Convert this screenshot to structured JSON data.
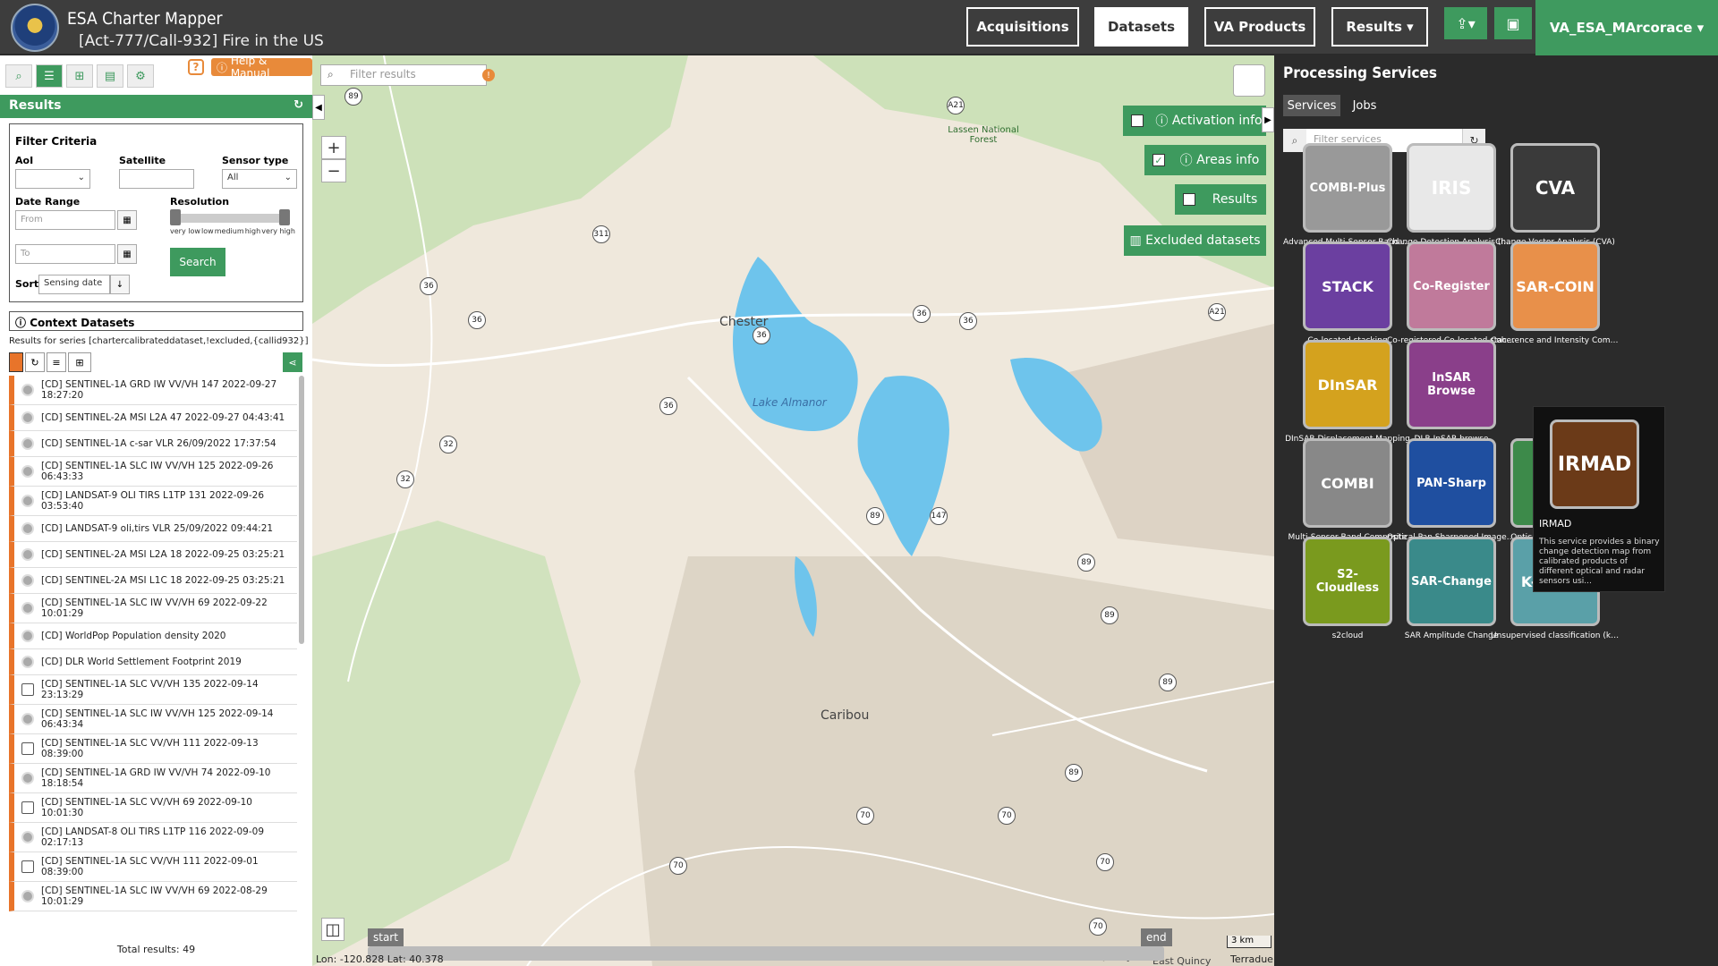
{
  "header": {
    "app_title": "ESA Charter Mapper",
    "call_title": "[Act-777/Call-932] Fire in the US",
    "nav": [
      "Acquisitions",
      "Datasets",
      "VA Products",
      "Results ▾"
    ],
    "user": "VA_ESA_MArcorace ▾"
  },
  "left": {
    "help": "Help & Manual",
    "help_q": "?",
    "results_title": "Results",
    "filter_title": "Filter Criteria",
    "aoi_label": "AoI",
    "satellite_label": "Satellite",
    "sensor_label": "Sensor type",
    "sensor_value": "All",
    "date_label": "Date Range",
    "from_placeholder": "From",
    "to_placeholder": "To",
    "resolution_label": "Resolution",
    "res_ticks": [
      "very low",
      "low",
      "medium",
      "high",
      "very high"
    ],
    "sort_label": "Sort",
    "sort_value": "Sensing date",
    "search_label": "Search",
    "context_title": "Context Datasets",
    "series_text": "Results for series [chartercalibrateddataset,!excluded,{callid932}]",
    "items": [
      {
        "text": "[CD] SENTINEL-1A GRD IW VV/VH 147 2022-09-27 18:27:20",
        "icon": "radar"
      },
      {
        "text": "[CD] SENTINEL-2A MSI L2A 47 2022-09-27 04:43:41",
        "icon": "optical"
      },
      {
        "text": "[CD] SENTINEL-1A c-sar VLR 26/09/2022 17:37:54",
        "icon": "optical"
      },
      {
        "text": "[CD] SENTINEL-1A SLC IW VV/VH 125 2022-09-26 06:43:33",
        "icon": "optical"
      },
      {
        "text": "[CD] LANDSAT-9 OLI TIRS L1TP 131 2022-09-26 03:53:40",
        "icon": "optical"
      },
      {
        "text": "[CD] LANDSAT-9 oli,tirs VLR 25/09/2022 09:44:21",
        "icon": "optical"
      },
      {
        "text": "[CD] SENTINEL-2A MSI L2A 18 2022-09-25 03:25:21",
        "icon": "optical"
      },
      {
        "text": "[CD] SENTINEL-2A MSI L1C 18 2022-09-25 03:25:21",
        "icon": "optical"
      },
      {
        "text": "[CD] SENTINEL-1A SLC IW VV/VH 69 2022-09-22 10:01:29",
        "icon": "optical"
      },
      {
        "text": "[CD] WorldPop Population density 2020",
        "icon": "optical"
      },
      {
        "text": "[CD] DLR World Settlement Footprint 2019",
        "icon": "optical"
      },
      {
        "text": "[CD] SENTINEL-1A SLC VV/VH 135 2022-09-14 23:13:29",
        "icon": "sq"
      },
      {
        "text": "[CD] SENTINEL-1A SLC IW VV/VH 125 2022-09-14 06:43:34",
        "icon": "optical"
      },
      {
        "text": "[CD] SENTINEL-1A SLC VV/VH 111 2022-09-13 08:39:00",
        "icon": "sq"
      },
      {
        "text": "[CD] SENTINEL-1A GRD IW VV/VH 74 2022-09-10 18:18:54",
        "icon": "optical"
      },
      {
        "text": "[CD] SENTINEL-1A SLC VV/VH 69 2022-09-10 10:01:30",
        "icon": "sq"
      },
      {
        "text": "[CD] LANDSAT-8 OLI TIRS L1TP 116 2022-09-09 02:17:13",
        "icon": "optical"
      },
      {
        "text": "[CD] SENTINEL-1A SLC VV/VH 111 2022-09-01 08:39:00",
        "icon": "sq"
      },
      {
        "text": "[CD] SENTINEL-1A SLC IW VV/VH 69 2022-08-29 10:01:29",
        "icon": "optical"
      }
    ],
    "total": "Total results: 49"
  },
  "map": {
    "filter_placeholder": "Filter results",
    "activation": "Activation info",
    "areas": "Areas info",
    "results": "Results",
    "excluded": "Excluded datasets",
    "start": "start",
    "end": "end",
    "coords": "Lon: -120.828 Lat: 40.378",
    "scale": "3 km",
    "attribution": "Terradue",
    "places": [
      {
        "name": "Chester"
      },
      {
        "name": "Lake Almanor"
      },
      {
        "name": "Caribou"
      },
      {
        "name": "Lassen National Forest"
      },
      {
        "name": "Quincy"
      },
      {
        "name": "East Quincy"
      }
    ],
    "routes": [
      "89",
      "A21",
      "311",
      "36",
      "36",
      "36",
      "36",
      "36",
      "A21",
      "36",
      "32",
      "32",
      "89",
      "147",
      "89",
      "89",
      "89",
      "89",
      "70",
      "70",
      "70",
      "70",
      "70"
    ]
  },
  "right": {
    "title": "Processing Services",
    "tab_services": "Services",
    "tab_jobs": "Jobs",
    "filter_placeholder": "Filter services",
    "services": [
      {
        "label": "COMBI-Plus",
        "caption": "Advanced Multi-Sensor Band C...",
        "color": "#999999"
      },
      {
        "label": "IRIS",
        "caption": "Change Detection Analysis (IR...",
        "color": "#e8e8e8"
      },
      {
        "label": "CVA",
        "caption": "Change Vector Analysis (CVA)",
        "color": "#3a3a3a"
      },
      {
        "label": "STACK",
        "caption": "Co-located stacking",
        "color": "#6b3fa0"
      },
      {
        "label": "Co-Register",
        "caption": "Co-registered Co-located stacki...",
        "color": "#c07a9b"
      },
      {
        "label": "SAR-COIN",
        "caption": "Coherence and Intensity Comp...",
        "color": "#e8904a"
      },
      {
        "label": "DInSAR",
        "caption": "DInSAR Displacement Mapping",
        "color": "#d4a21e"
      },
      {
        "label": "InSAR Browse",
        "caption": "DLR InSAR browse",
        "color": "#8a3f8a"
      },
      {
        "label": "",
        "caption": "Optical Spectral Index",
        "color": "#3d8a4a"
      },
      {
        "label": "COMBI",
        "caption": "Multi-Sensor Band Composite",
        "color": "#888888"
      },
      {
        "label": "PAN-Sharp",
        "caption": "Optical Pan Sharpened Image ...",
        "color": "#1f4fa0"
      },
      {
        "label": "S2-Cloudless",
        "caption": "s2cloud",
        "color": "#7a9a1e"
      },
      {
        "label": "SAR-Change",
        "caption": "SAR Amplitude Change",
        "color": "#3a8a8a"
      },
      {
        "label": "K-Means",
        "caption": "Unsupervised classification (k-...",
        "color": "#5aa0a8"
      }
    ],
    "tooltip": {
      "label": "IRMAD",
      "title": "IRMAD",
      "desc": "This service provides a binary change detection map from calibrated products of different optical and radar sensors usi..."
    }
  }
}
